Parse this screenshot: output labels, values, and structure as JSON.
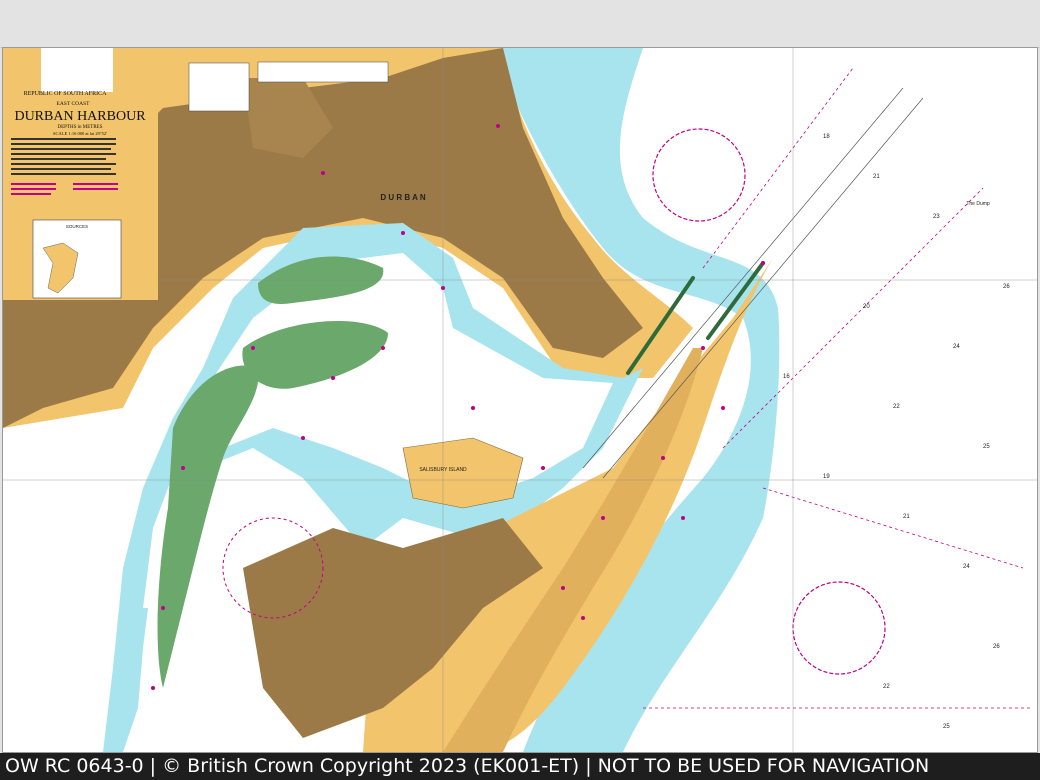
{
  "chart": {
    "country": "REPUBLIC OF SOUTH AFRICA",
    "coast": "EAST COAST",
    "title": "DURBAN HARBOUR",
    "depths": "DEPTHS in METRES",
    "scale": "SCALE 1:16 000 at lat 29°52'"
  },
  "labels": {
    "city": "D U R B A N",
    "salisbury_island": "SALISBURY ISLAND",
    "the_dump": "The Dump"
  },
  "inset": {
    "title": "SOURCES"
  },
  "footer": {
    "text": "OW RC 0643-0 | © British Crown Copyright 2023 (EK001-ET) | NOT TO BE USED FOR NAVIGATION"
  },
  "colors": {
    "land": "#f2c46c",
    "built_up": "#9c7a48",
    "shallow_water": "#a8e4ee",
    "deep_water": "#ffffff",
    "drying": "#6aa86c",
    "magenta": "#c0008a",
    "footer_bg": "#1e1e1e"
  }
}
